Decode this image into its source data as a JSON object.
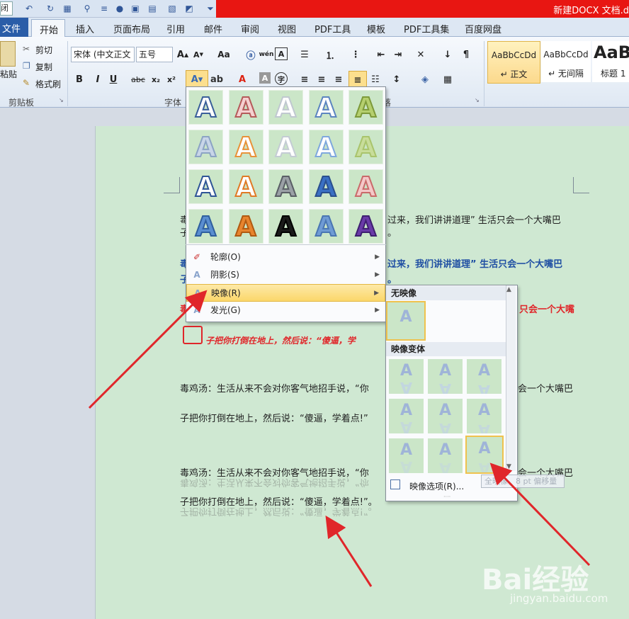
{
  "window": {
    "title": "新建DOCX 文档.d",
    "close_partial": "闭",
    "colors": {
      "title_bar_red": "#e81612",
      "ribbon_blue": "#2a5da8"
    }
  },
  "tabs": {
    "file": "文件",
    "items": [
      "开始",
      "插入",
      "页面布局",
      "引用",
      "邮件",
      "审阅",
      "视图",
      "PDF工具",
      "模板",
      "PDF工具集",
      "百度网盘"
    ]
  },
  "clipboard": {
    "paste": "粘贴",
    "cut": "剪切",
    "copy": "复制",
    "format_painter": "格式刷",
    "group_label": "剪贴板"
  },
  "font": {
    "font_name": "宋体 (中文正文",
    "font_size": "五号",
    "group_label": "字体",
    "bold": "B",
    "italic": "I",
    "underline": "U",
    "strike": "abc",
    "subscript": "x₂",
    "superscript": "x²",
    "case_btn": "Aa",
    "pinyin": "wén"
  },
  "paragraph": {
    "group_label_partial": "落"
  },
  "styles": [
    {
      "sample": "AaBbCcDd",
      "name": "↵ 正文",
      "selected": true
    },
    {
      "sample": "AaBbCcDd",
      "name": "↵ 无间隔",
      "selected": false
    },
    {
      "sample": "AaB",
      "name": "标题 1",
      "selected": false
    }
  ],
  "effects_menu": {
    "grid_icon": "letter-A-styles",
    "grid_letter": "A",
    "items": [
      {
        "label": "轮廓(O)",
        "icon": "outline-pen-icon"
      },
      {
        "label": "阴影(S)",
        "icon": "shadow-A-icon"
      },
      {
        "label": "映像(R)",
        "icon": "reflection-A-icon",
        "active": true
      },
      {
        "label": "发光(G)",
        "icon": "glow-A-icon"
      }
    ]
  },
  "reflection_submenu": {
    "no_reflection_header": "无映像",
    "variants_header": "映像变体",
    "options_label": "映像选项(R)...",
    "tooltip": "全映像，8 pt 偏移量"
  },
  "document": {
    "line1_visible_a": "毒",
    "line1_visible_b": "过来，我们讲讲道理” 生活只会一个大嘴巴",
    "line2_visible_a": "子",
    "line2_visible_b": "。",
    "blue_line_a": "毒",
    "blue_line_b": "过来，我们讲讲道理” 生活只会一个大嘴巴",
    "blue_line2_a": "子",
    "blue_line2_b": "。",
    "red_line_a": "毒",
    "red_line_b": "只会一个大嘴",
    "red_line2": "子把你打倒在地上，然后说：“傻逼，学",
    "para1_line1": "毒鸡汤：生活从来不会对你客气地招手说，“你",
    "para1_line1_right": "会一个大嘴巴",
    "para1_line2": "子把你打倒在地上，然后说：“傻逼，学着点!”",
    "para2_line1": "毒鸡汤：生活从来不会对你客气地招手说，“你",
    "para2_line1_right": "会一个大嘴巴",
    "para2_line2": "子把你打倒在地上，然后说：“傻逼，学着点!”。"
  },
  "watermark": {
    "brand": "Bai经验",
    "url": "jingyan.baidu.com"
  }
}
